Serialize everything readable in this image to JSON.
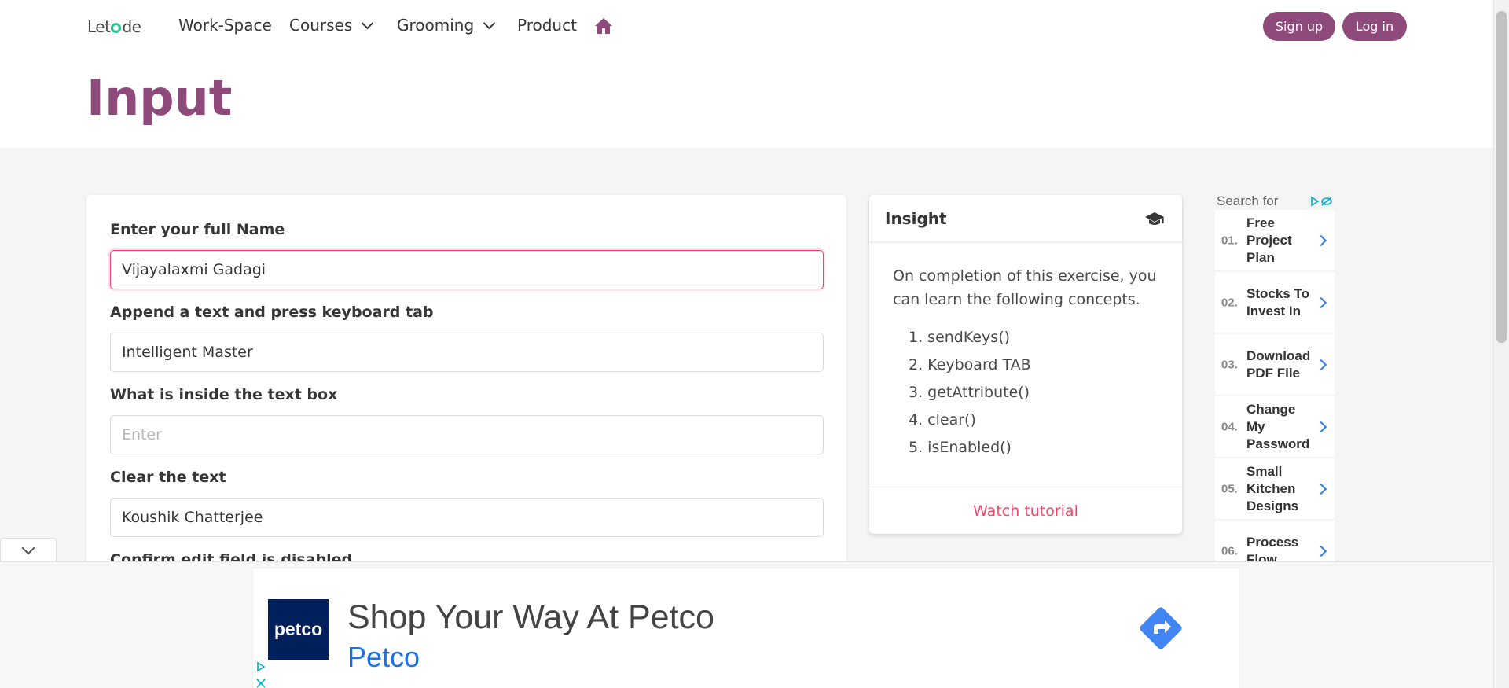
{
  "nav": {
    "brand_left": "Let",
    "brand_right": "de",
    "items": [
      {
        "label": "Work-Space"
      },
      {
        "label": "Courses"
      },
      {
        "label": "Grooming"
      },
      {
        "label": "Product"
      }
    ],
    "signup_label": "Sign up",
    "login_label": "Log in"
  },
  "page": {
    "title": "Input"
  },
  "form": {
    "fields": [
      {
        "label": "Enter your full Name",
        "value": "Vijayalaxmi Gadagi"
      },
      {
        "label": "Append a text and press keyboard tab",
        "value": "Intelligent Master"
      },
      {
        "label": "What is inside the text box",
        "value": "",
        "placeholder": "Enter"
      },
      {
        "label": "Clear the text",
        "value": "Koushik Chatterjee"
      },
      {
        "label": "Confirm edit field is disabled"
      }
    ]
  },
  "insight": {
    "title": "Insight",
    "intro": "On completion of this exercise, you can learn the following concepts.",
    "concepts": [
      "1. sendKeys()",
      "2. Keyboard TAB",
      "3. getAttribute()",
      "4. clear()",
      "5. isEnabled()"
    ],
    "footer_link": "Watch tutorial"
  },
  "side_ads": {
    "header": "Search for",
    "items": [
      {
        "num": "01.",
        "text": "Free Project Plan"
      },
      {
        "num": "02.",
        "text": "Stocks To Invest In"
      },
      {
        "num": "03.",
        "text": "Download PDF File"
      },
      {
        "num": "04.",
        "text": "Change My Password"
      },
      {
        "num": "05.",
        "text": "Small Kitchen Designs"
      },
      {
        "num": "06.",
        "text": "Process Flow"
      }
    ]
  },
  "bottom_ad": {
    "logo_text": "petco",
    "title": "Shop Your Way At Petco",
    "brand": "Petco"
  },
  "colors": {
    "brand_purple": "#8e4a7b",
    "danger_pink": "#f14668",
    "ad_blue": "#2b7de9"
  }
}
